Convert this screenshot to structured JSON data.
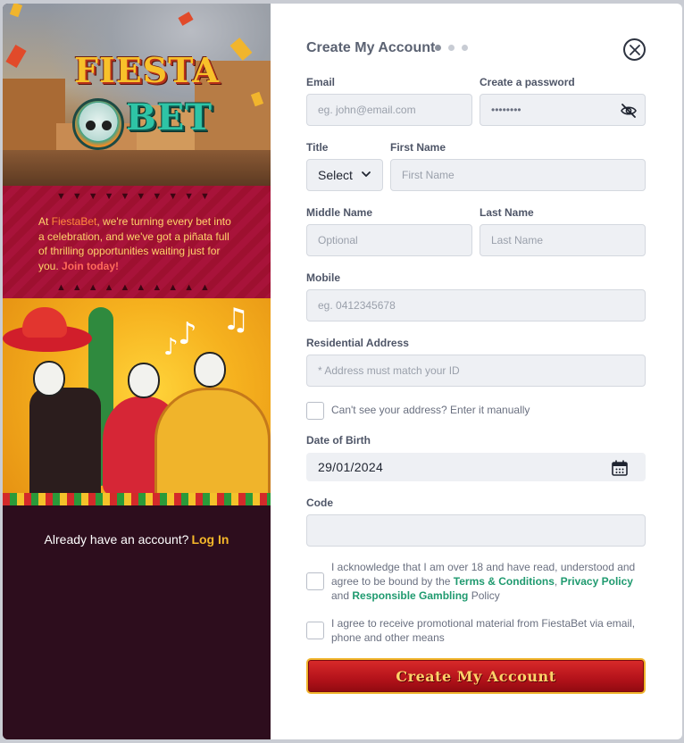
{
  "branding": {
    "logo_top": "FIESTA",
    "logo_bottom": "BET"
  },
  "promo": {
    "prefix": "At ",
    "brand": "FiestaBet",
    "body": ", we're turning every bet into a celebration, and we've got a piñata full of thrilling opportunities waiting just for you. ",
    "cta": "Join today!",
    "triangles_top": "▼▼▼▼▼▼▼▼▼▼",
    "triangles_bottom": "▲▲▲▲▲▲▲▲▲▲"
  },
  "art": {
    "notes": [
      "♪",
      "♫",
      "♪"
    ]
  },
  "login_prompt": {
    "text": "Already have an account?",
    "link": "Log In"
  },
  "form": {
    "title": "Create My Account",
    "steps": 3,
    "active_step": 1,
    "email": {
      "label": "Email",
      "placeholder": "eg. john@email.com"
    },
    "password": {
      "label": "Create a password",
      "value": "••••••••"
    },
    "title_field": {
      "label": "Title",
      "value": "Select"
    },
    "first_name": {
      "label": "First Name",
      "placeholder": "First Name"
    },
    "middle_name": {
      "label": "Middle Name",
      "placeholder": "Optional"
    },
    "last_name": {
      "label": "Last Name",
      "placeholder": "Last Name"
    },
    "mobile": {
      "label": "Mobile",
      "placeholder": "eg. 0412345678"
    },
    "address": {
      "label": "Residential Address",
      "placeholder": "* Address must match your ID"
    },
    "manual_address": {
      "label": "Can't see your address? Enter it manually",
      "checked": false
    },
    "dob": {
      "label": "Date of Birth",
      "value": "29/01/2024"
    },
    "code": {
      "label": "Code",
      "value": ""
    },
    "terms": {
      "text_1": "I acknowledge that I am over 18 and have read, understood and agree to be bound by the ",
      "link_terms": "Terms & Conditions",
      "sep": ", ",
      "link_privacy": "Privacy Policy",
      "and": " and ",
      "link_rg": "Responsible Gambling",
      "text_2": " Policy",
      "checked": false
    },
    "marketing": {
      "text": "I agree to receive promotional material from FiestaBet via email, phone and other means",
      "checked": false
    },
    "submit_label": "Create My Account"
  },
  "colors": {
    "accent_gold": "#f5b72a",
    "link_green": "#1f9a6f",
    "cta_red": "#b3121a",
    "dark_panel": "#2d0d1d"
  }
}
